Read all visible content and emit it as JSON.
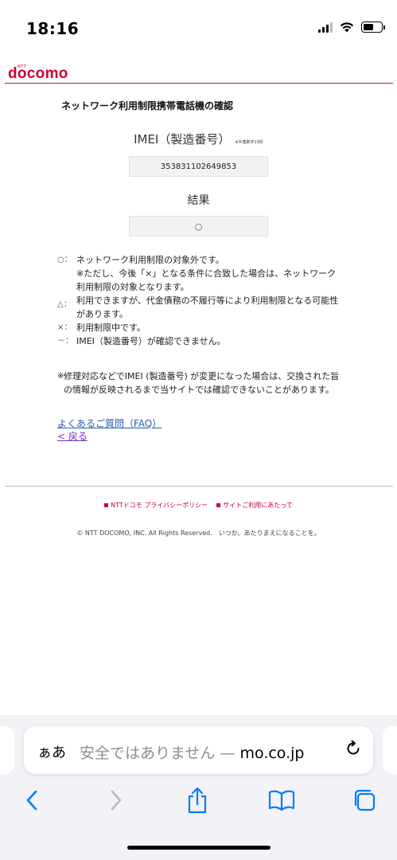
{
  "status_bar": {
    "time": "18:16"
  },
  "header": {
    "logo_sub": "NTT",
    "logo": "docomo"
  },
  "main": {
    "title": "ネットワーク利用制限携帯電話機の確認",
    "imei_label": "IMEI（製造番号）",
    "imei_note": "※半角数字15桁",
    "imei_value": "353831102649853",
    "result_label": "結果",
    "result_value": "○",
    "legend": [
      {
        "symbol": "○：",
        "text": "ネットワーク利用制限の対象外です。"
      },
      {
        "note": "※ただし、今後「×」となる条件に合致した場合は、ネットワーク利用制限の対象となります。"
      },
      {
        "symbol": "△：",
        "text": "利用できますが、代金債務の不履行等により利用制限となる可能性があります。"
      },
      {
        "symbol": "×：",
        "text": "利用制限中です。"
      },
      {
        "symbol": "－：",
        "text": "IMEI（製造番号）が確認できません。"
      }
    ],
    "footnote_mark": "※",
    "footnote": "修理対応などでIMEI (製造番号) が変更になった場合は、交換された旨の情報が反映されるまで当サイトでは確認できないことがあります。",
    "faq_link": "よくあるご質問（FAQ）",
    "back_link": "< 戻る"
  },
  "footer": {
    "links": [
      "NTTドコモ プライバシーポリシー",
      "サイトご利用にあたって"
    ],
    "copyright": "© NTT DOCOMO, INC. All Rights Reserved.　いつか、あたりまえになることを。"
  },
  "browser": {
    "aa": "ぁあ",
    "url_prefix": "安全ではありません — ",
    "url_host": "mo.co.jp",
    "reload_icon": "reload-icon"
  },
  "colors": {
    "brand": "#cc0033",
    "link": "#2a5db0",
    "visited": "#7a2cc4",
    "ios_blue": "#007aff"
  }
}
